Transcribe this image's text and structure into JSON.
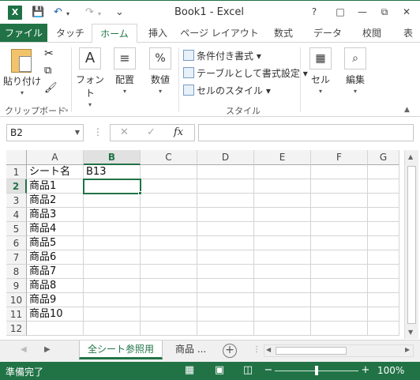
{
  "window": {
    "title": "Book1 - Excel",
    "logo": "X",
    "controls": [
      "?",
      "□",
      "—",
      "⧉",
      "✕"
    ]
  },
  "qat": {
    "save_icon": "💾",
    "undo_icon": "↶",
    "redo_icon": "↷",
    "more_icon": "⌄"
  },
  "tabs": {
    "file": "ファイル",
    "items": [
      "タッチ",
      "ホーム",
      "挿入",
      "ページ レイアウト",
      "数式",
      "データ",
      "校閲",
      "表"
    ]
  },
  "ribbon": {
    "paste": "貼り付け",
    "clipboard_label": "クリップボード",
    "font": "フォント",
    "alignment": "配置",
    "number": "数値",
    "number_symbol": "%",
    "cond_format": "条件付き書式",
    "format_table": "テーブルとして書式設定",
    "cell_styles": "セルのスタイル",
    "style_label": "スタイル",
    "cells": "セル",
    "editing": "編集"
  },
  "formula_bar": {
    "name_box": "B2",
    "cancel": "✕",
    "enter": "✓",
    "fx": "fx",
    "formula": ""
  },
  "grid": {
    "columns": [
      "A",
      "B",
      "C",
      "D",
      "E",
      "F",
      "G"
    ],
    "rows": [
      "1",
      "2",
      "3",
      "4",
      "5",
      "6",
      "7",
      "8",
      "9",
      "10",
      "11",
      "12"
    ],
    "colA": [
      "シート名",
      "商品1",
      "商品2",
      "商品3",
      "商品4",
      "商品5",
      "商品6",
      "商品7",
      "商品8",
      "商品9",
      "商品10",
      ""
    ],
    "b1": "B13"
  },
  "sheets": {
    "active": "全シート参照用",
    "next": "商品 ...",
    "add": "+"
  },
  "statusbar": {
    "status": "準備完了",
    "zoom_minus": "−",
    "zoom_plus": "+",
    "zoom": "100%",
    "zoom_level": 0.5
  }
}
